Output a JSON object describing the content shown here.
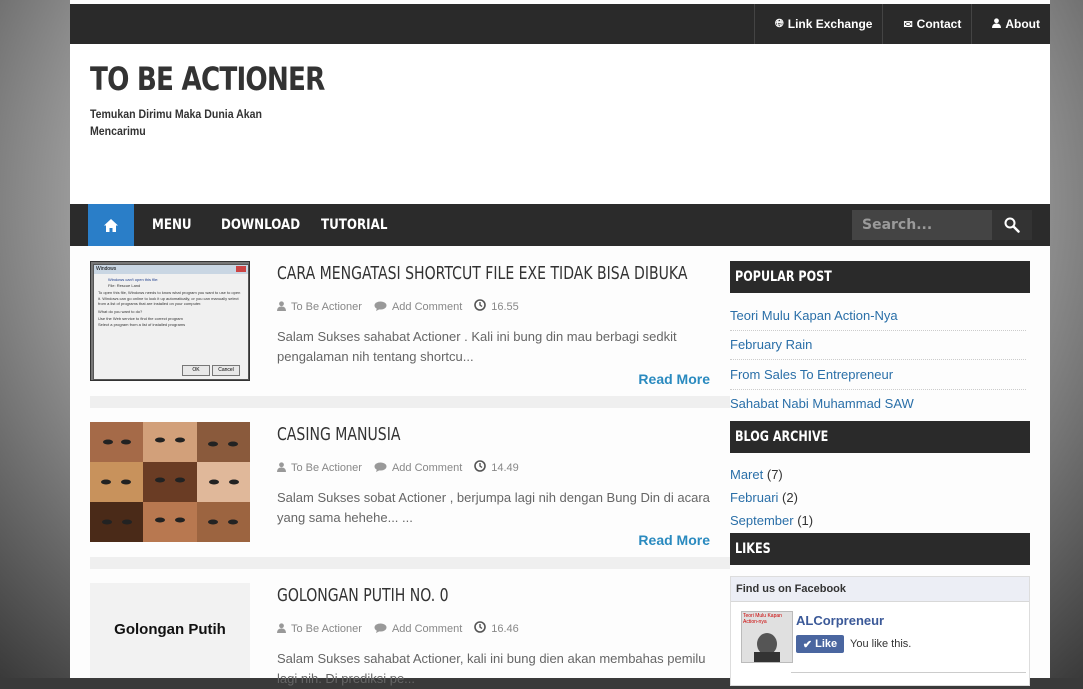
{
  "top_nav": {
    "items": [
      {
        "label": "Link Exchange",
        "icon": "globe-icon"
      },
      {
        "label": "Contact",
        "icon": "envelope-icon"
      },
      {
        "label": "About",
        "icon": "user-icon"
      }
    ]
  },
  "header": {
    "title": "TO BE ACTIONER",
    "description": "Temukan Dirimu Maka Dunia Akan Mencarimu"
  },
  "main_nav": {
    "home_icon": "home-icon",
    "items": [
      "MENU",
      "DOWNLOAD",
      "TUTORIAL"
    ],
    "search_placeholder": "Search..."
  },
  "posts": [
    {
      "title": "CARA MENGATASI SHORTCUT FILE EXE TIDAK BISA DIBUKA",
      "author": "To Be Actioner",
      "comment": "Add Comment",
      "time": "16.55",
      "excerpt": "Salam Sukses sahabat Actioner . Kali ini bung din mau berbagi sedkit pengalaman nih tentang shortcu...",
      "read_more": "Read More",
      "thumb": {
        "title": "Windows",
        "heading": "Windows can't open this file:",
        "file_label": "File:",
        "file_name": "Rescue Land",
        "body": "To open this file, Windows needs to know what program you want to use to open it. Windows can go online to look it up automatically, or you can manually select from a list of programs that are installed on your computer.",
        "question": "What do you want to do?",
        "option1": "Use the Web service to find the correct program",
        "option2": "Select a program from a list of installed programs",
        "ok": "OK",
        "cancel": "Cancel"
      }
    },
    {
      "title": "CASING MANUSIA",
      "author": "To Be Actioner",
      "comment": "Add Comment",
      "time": "14.49",
      "excerpt": "Salam Sukses sobat Actioner , berjumpa lagi nih dengan Bung Din di acara yang sama hehehe... ...",
      "read_more": "Read More"
    },
    {
      "title": "GOLONGAN PUTIH NO. 0",
      "author": "To Be Actioner",
      "comment": "Add Comment",
      "time": "16.46",
      "excerpt": "Salam Sukses sahabat Actioner, kali ini bung dien akan membahas pemilu lagi nih. Di prediksi pe...",
      "thumb_text": "Golongan Putih"
    }
  ],
  "sidebar": {
    "popular_title": "POPULAR POST",
    "popular": [
      "Teori Mulu Kapan Action-Nya",
      "February Rain",
      "From Sales To Entrepreneur",
      "Sahabat Nabi Muhammad SAW"
    ],
    "archive_title": "BLOG ARCHIVE",
    "archive": [
      {
        "month": "Maret",
        "count": "(7)"
      },
      {
        "month": "Februari",
        "count": "(2)"
      },
      {
        "month": "September",
        "count": "(1)"
      }
    ],
    "likes_title": "LIKES",
    "facebook": {
      "header": "Find us on Facebook",
      "page_name": "ALCorpreneur",
      "like_button": "Like",
      "like_text": "You like this.",
      "avatar_text": "Teori Mulu Kapan Action-nya"
    }
  }
}
